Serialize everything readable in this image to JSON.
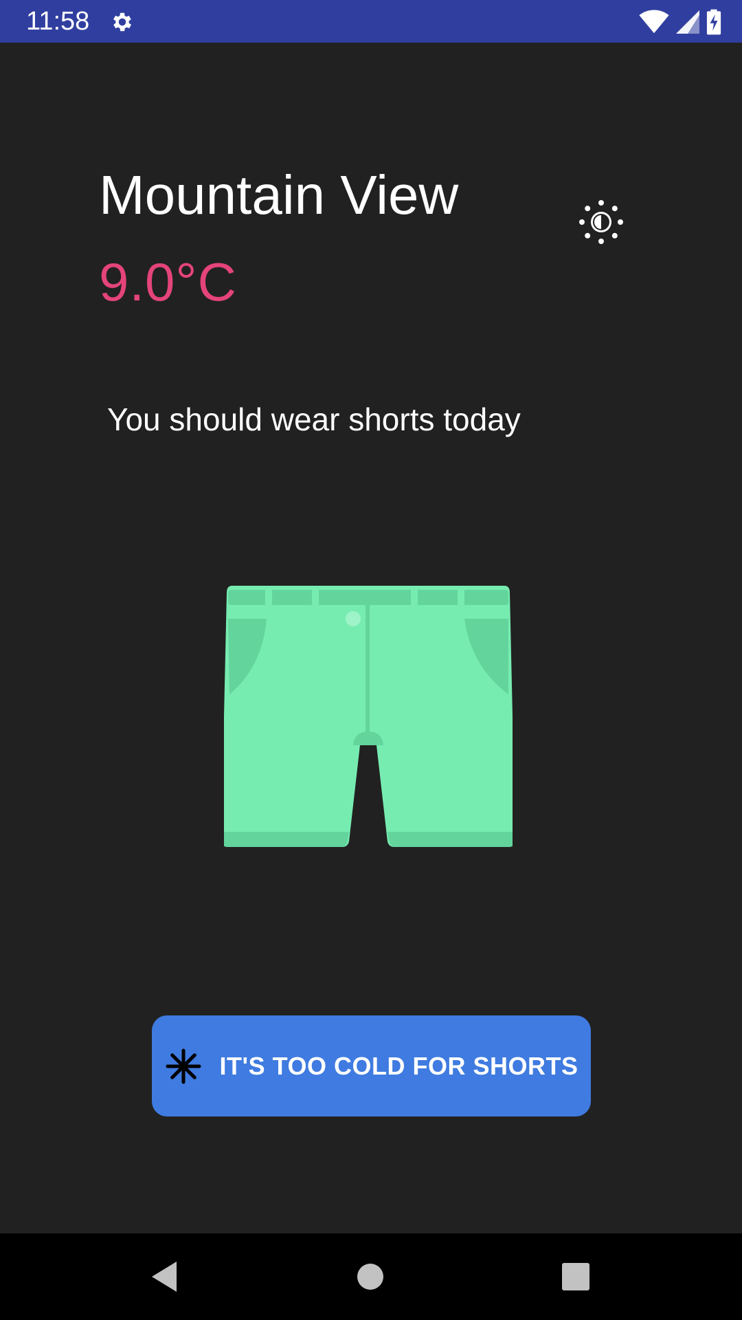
{
  "status_bar": {
    "time": "11:58",
    "background": "#303f9f",
    "icons": [
      "gear-icon",
      "wifi-icon",
      "cell-signal-icon",
      "battery-charging-icon"
    ]
  },
  "weather": {
    "city": "Mountain View",
    "temperature": "9.0°C",
    "temperature_color": "#e4447a",
    "theme_icon": "brightness-icon"
  },
  "advice": {
    "text": "You should wear shorts today",
    "illustration_icon": "shorts-icon",
    "illustration_color": "#77ecb1"
  },
  "action": {
    "label": "IT'S TOO COLD FOR SHORTS",
    "icon": "snowflake-icon",
    "color": "#3f7be0"
  },
  "nav_bar": {
    "buttons": [
      "back-icon",
      "home-icon",
      "recents-icon"
    ]
  }
}
